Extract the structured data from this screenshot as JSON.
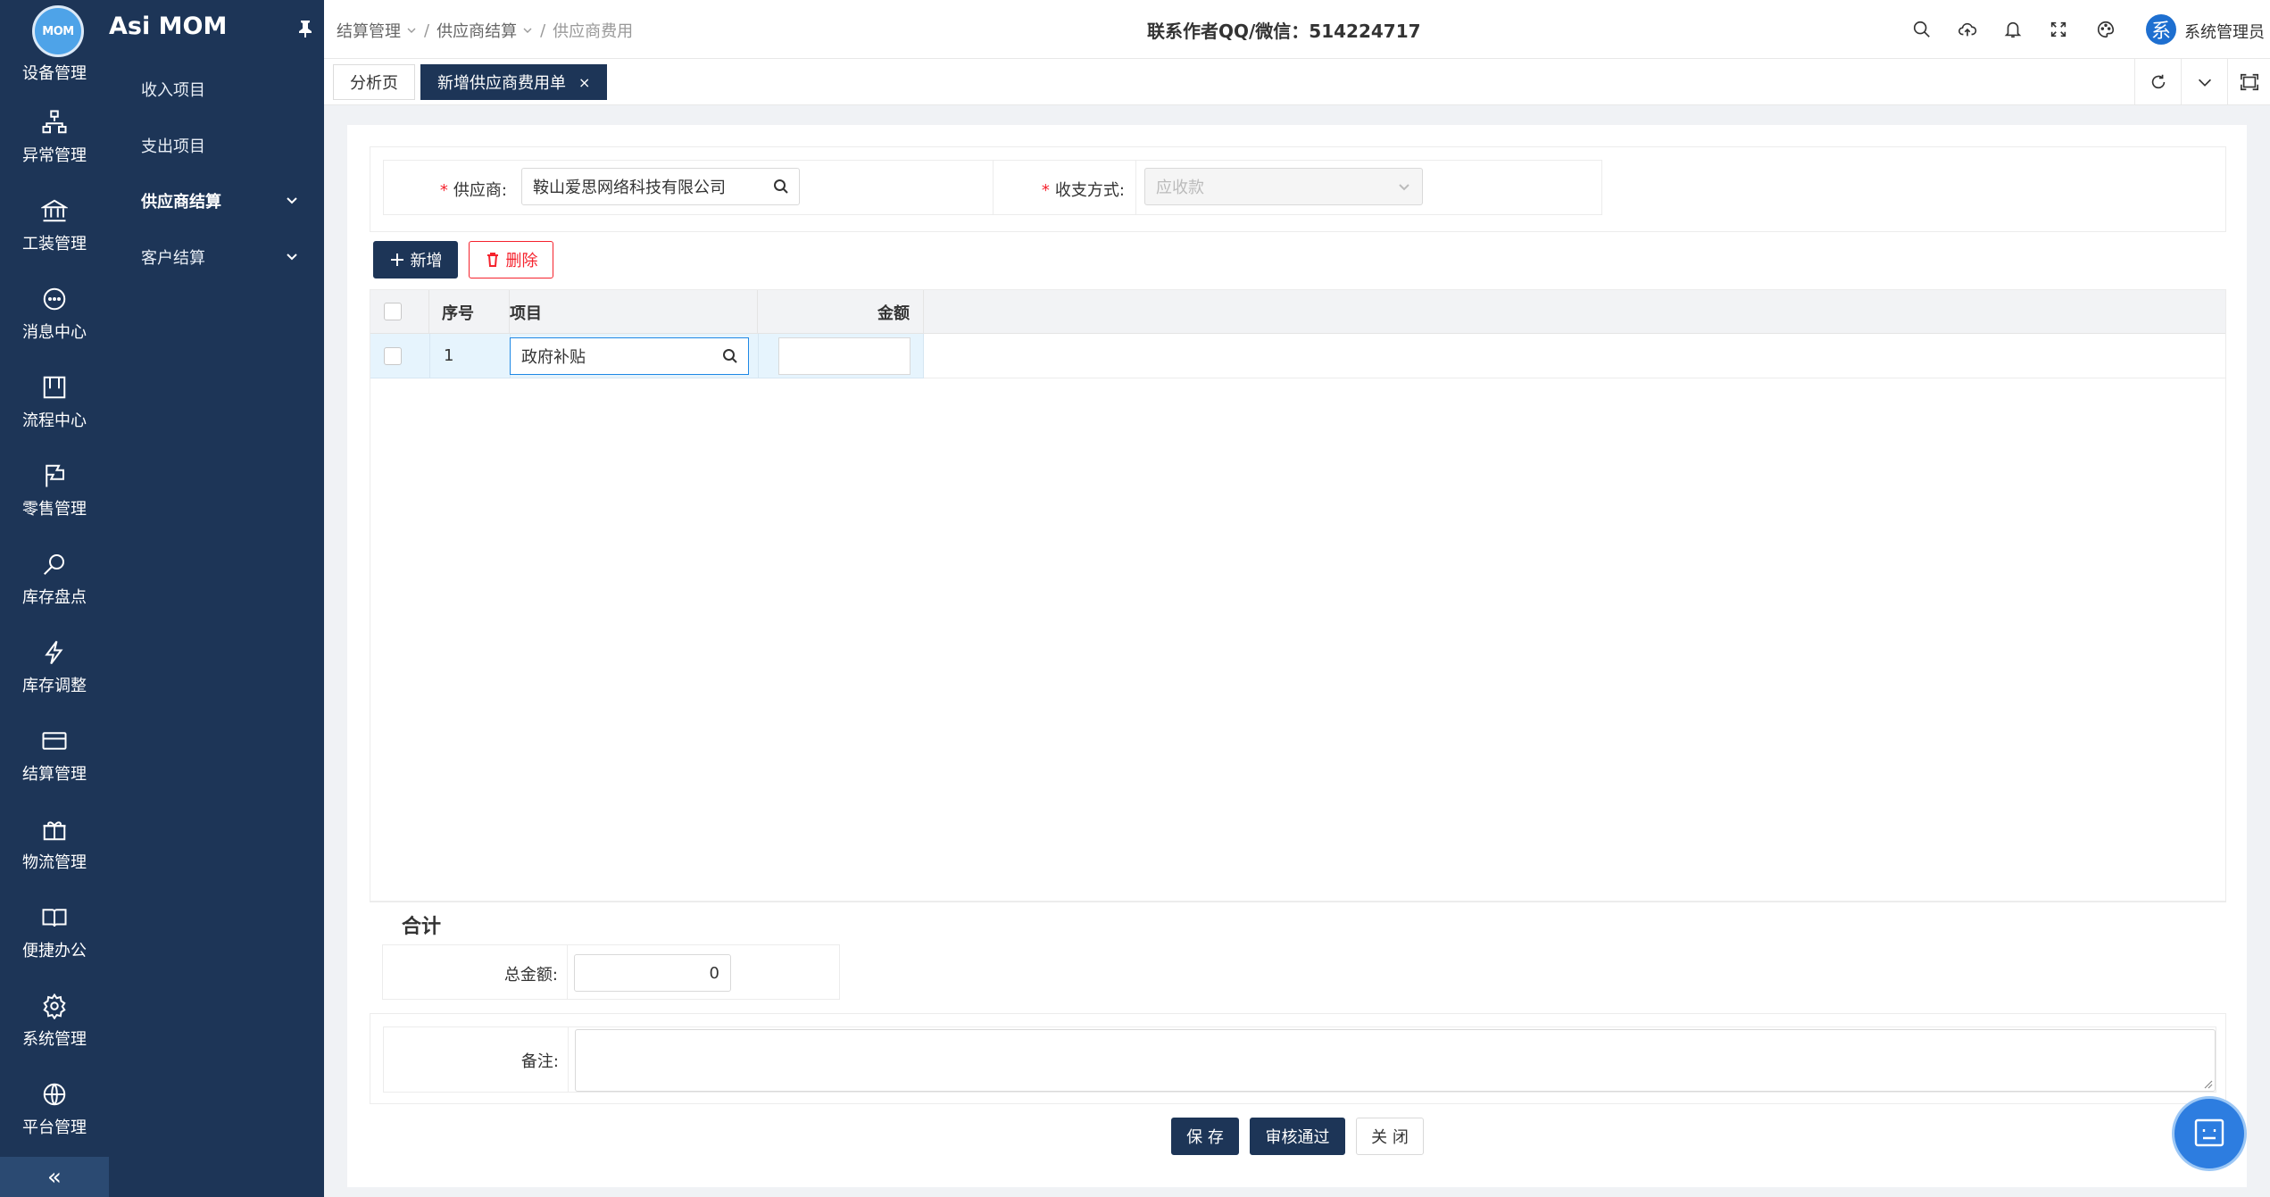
{
  "app": {
    "title": "Asi MOM",
    "logo_text": "MOM"
  },
  "rail": {
    "items": [
      {
        "label": "设备管理",
        "icon": "device-icon"
      },
      {
        "label": "异常管理",
        "icon": "hierarchy-icon"
      },
      {
        "label": "工装管理",
        "icon": "bank-icon"
      },
      {
        "label": "消息中心",
        "icon": "chat-icon"
      },
      {
        "label": "流程中心",
        "icon": "board-icon"
      },
      {
        "label": "零售管理",
        "icon": "flag-icon"
      },
      {
        "label": "库存盘点",
        "icon": "search-icon"
      },
      {
        "label": "库存调整",
        "icon": "lightning-icon"
      },
      {
        "label": "结算管理",
        "icon": "card-icon"
      },
      {
        "label": "物流管理",
        "icon": "gift-icon"
      },
      {
        "label": "便捷办公",
        "icon": "book-icon"
      },
      {
        "label": "系统管理",
        "icon": "gear-icon"
      },
      {
        "label": "平台管理",
        "icon": "globe-icon"
      }
    ],
    "collapse_label": "«"
  },
  "submenu": {
    "items": [
      {
        "label": "收入项目",
        "bold": false,
        "has_chevron": false
      },
      {
        "label": "支出项目",
        "bold": false,
        "has_chevron": false
      },
      {
        "label": "供应商结算",
        "bold": true,
        "has_chevron": true
      },
      {
        "label": "客户结算",
        "bold": false,
        "has_chevron": true
      }
    ]
  },
  "header": {
    "breadcrumb": [
      "结算管理",
      "供应商结算",
      "供应商费用"
    ],
    "contact": "联系作者QQ/微信：514224717",
    "avatar_char": "系",
    "user_name": "系统管理员"
  },
  "tabs": [
    {
      "label": "分析页",
      "active": false
    },
    {
      "label": "新增供应商费用单",
      "active": true,
      "close": "×"
    }
  ],
  "form": {
    "supplier_label": "供应商:",
    "supplier_value": "鞍山爱思网络科技有限公司",
    "method_label": "收支方式:",
    "method_placeholder": "应收款",
    "required_mark": "*"
  },
  "toolbar": {
    "add_label": "新增",
    "delete_label": "删除"
  },
  "grid": {
    "columns": [
      "序号",
      "项目",
      "金额"
    ],
    "rows": [
      {
        "index": "1",
        "item": "政府补贴",
        "amount": ""
      }
    ]
  },
  "summary": {
    "title": "合计",
    "total_label": "总金额:",
    "total_value": "0"
  },
  "remark": {
    "label": "备注:",
    "value": ""
  },
  "actions": {
    "save": "保 存",
    "approve": "审核通过",
    "close": "关 闭"
  },
  "colors": {
    "nav_bg": "#1d3557",
    "primary": "#1d3557",
    "danger": "#f5222d",
    "row_highlight": "#e6f4fd"
  }
}
